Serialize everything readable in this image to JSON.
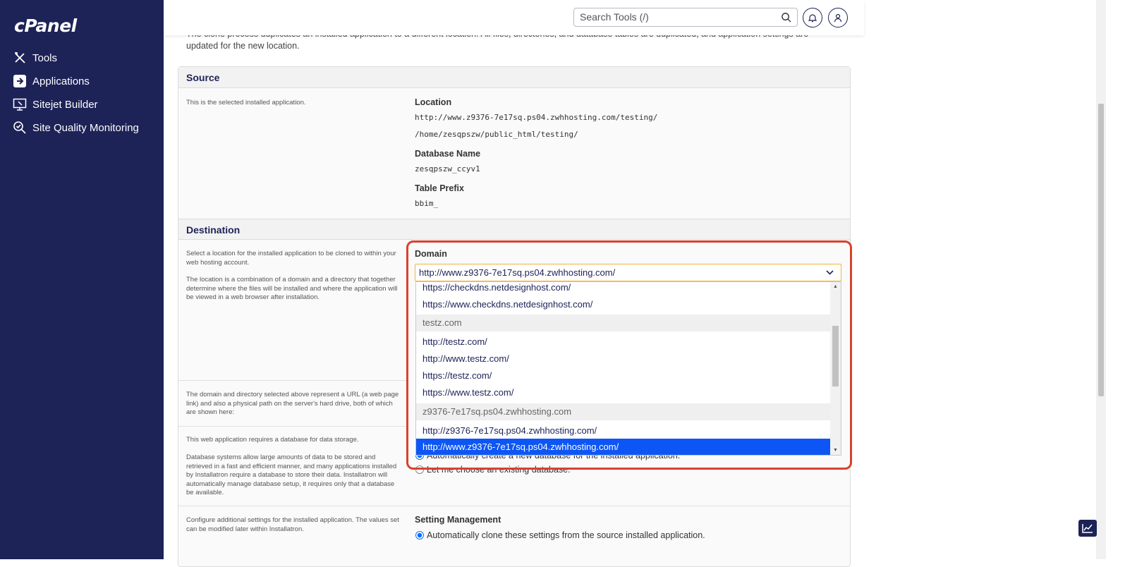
{
  "brand": {
    "logo": "cPanel"
  },
  "sidebar": {
    "items": [
      {
        "label": "Tools",
        "icon": "tools-icon"
      },
      {
        "label": "Applications",
        "icon": "applications-icon"
      },
      {
        "label": "Sitejet Builder",
        "icon": "sitejet-icon"
      },
      {
        "label": "Site Quality Monitoring",
        "icon": "site-quality-icon"
      }
    ]
  },
  "header": {
    "search_placeholder": "Search Tools (/)"
  },
  "intro": "The clone process duplicates an installed application to a different location. All files, directories, and database tables are duplicated, and application settings are updated for the new location.",
  "source": {
    "title": "Source",
    "description": "This is the selected installed application.",
    "location_label": "Location",
    "location_url": "http://www.z9376-7e17sq.ps04.zwhhosting.com/testing/",
    "location_path": "/home/zesqpszw/public_html/testing/",
    "db_label": "Database Name",
    "db_value": "zesqpszw_ccyv1",
    "prefix_label": "Table Prefix",
    "prefix_value": "bbim_"
  },
  "destination": {
    "title": "Destination",
    "desc1": "Select a location for the installed application to be cloned to within your web hosting account.",
    "desc2": "The location is a combination of a domain and a directory that together determine where the files will be installed and where the application will be viewed in a web browser after installation.",
    "desc3": "The domain and directory selected above represent a URL (a web page link) and also a physical path on the server's hard drive, both of which are shown here:",
    "desc4": "This web application requires a database for data storage.",
    "desc5": "Database systems allow large amounts of data to be stored and retrieved in a fast and efficient manner, and many applications installed by Installatron require a database to store their data. Installatron will automatically manage database setup, it requires only that a database be available.",
    "db_auto_option": "Automatically create a new database for the installed application.",
    "db_choose_option": "Let me choose an existing database.",
    "domain_label": "Domain",
    "domain_selected": "http://www.z9376-7e17sq.ps04.zwhhosting.com/",
    "domain_options": [
      {
        "text": "https://checkdns.netdesignhost.com/",
        "type": "option"
      },
      {
        "text": "https://www.checkdns.netdesignhost.com/",
        "type": "option"
      },
      {
        "text": "testz.com",
        "type": "group"
      },
      {
        "text": "http://testz.com/",
        "type": "option"
      },
      {
        "text": "http://www.testz.com/",
        "type": "option"
      },
      {
        "text": "https://testz.com/",
        "type": "option"
      },
      {
        "text": "https://www.testz.com/",
        "type": "option"
      },
      {
        "text": "z9376-7e17sq.ps04.zwhhosting.com",
        "type": "group"
      },
      {
        "text": "http://z9376-7e17sq.ps04.zwhhosting.com/",
        "type": "option"
      },
      {
        "text": "http://www.z9376-7e17sq.ps04.zwhhosting.com/",
        "type": "selected"
      }
    ]
  },
  "settings": {
    "desc": "Configure additional settings for the installed application. The values set can be modified later within Installatron.",
    "label": "Setting Management",
    "option": "Automatically clone these settings from the source installed application."
  },
  "colors": {
    "sidebar": "#1d2257",
    "highlight": "#d9422b",
    "selected": "#0d56f5"
  }
}
